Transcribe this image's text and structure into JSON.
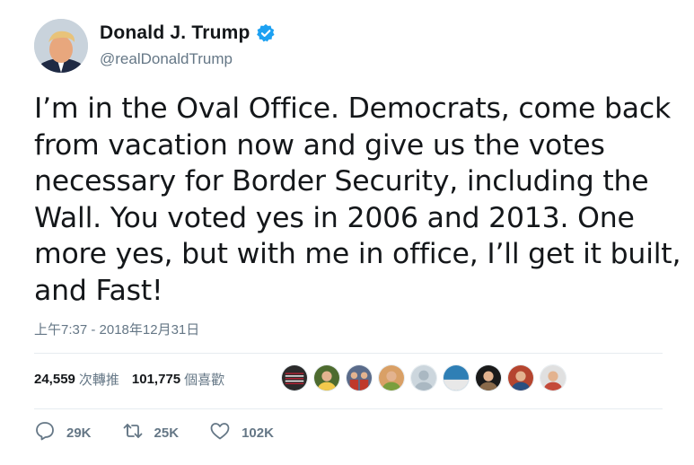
{
  "author": {
    "name": "Donald J. Trump",
    "handle": "@realDonaldTrump",
    "verified_color": "#1da1f2"
  },
  "tweet": {
    "text": "I’m in the Oval Office. Democrats, come back from vacation now and give us the votes necessary for Border Security, including the Wall. You voted yes in 2006 and 2013. One more yes, but with me in office, I’ll get it built, and Fast!",
    "timestamp": "上午7:37 - 2018年12月31日"
  },
  "stats": {
    "retweets_count": "24,559",
    "retweets_label": "次轉推",
    "likes_count": "101,775",
    "likes_label": "個喜歡"
  },
  "likers": [
    {
      "icon": "flag-avatar",
      "bg": "#2b2b2b",
      "accent": "#b22234"
    },
    {
      "icon": "person-avatar",
      "bg": "#4d6b2f",
      "accent": "#f2c94c"
    },
    {
      "icon": "group-avatar",
      "bg": "#5a6b8a",
      "accent": "#c0392b"
    },
    {
      "icon": "person-avatar",
      "bg": "#d9a066",
      "accent": "#7a9e3d"
    },
    {
      "icon": "default-avatar",
      "bg": "#ccd6dd",
      "accent": "#aab8c2"
    },
    {
      "icon": "landscape-avatar",
      "bg": "#2f7fb5",
      "accent": "#e8e8e8"
    },
    {
      "icon": "person-avatar",
      "bg": "#1a1a1a",
      "accent": "#8a6a4a"
    },
    {
      "icon": "person-avatar",
      "bg": "#b5452f",
      "accent": "#2b4f80"
    },
    {
      "icon": "person-avatar",
      "bg": "#e0e0e0",
      "accent": "#c44a3a"
    }
  ],
  "actions": {
    "replies": "29K",
    "retweets": "25K",
    "likes": "102K"
  },
  "colors": {
    "secondary_text": "#657786",
    "primary_text": "#14171a",
    "divider": "#e6ecf0"
  }
}
